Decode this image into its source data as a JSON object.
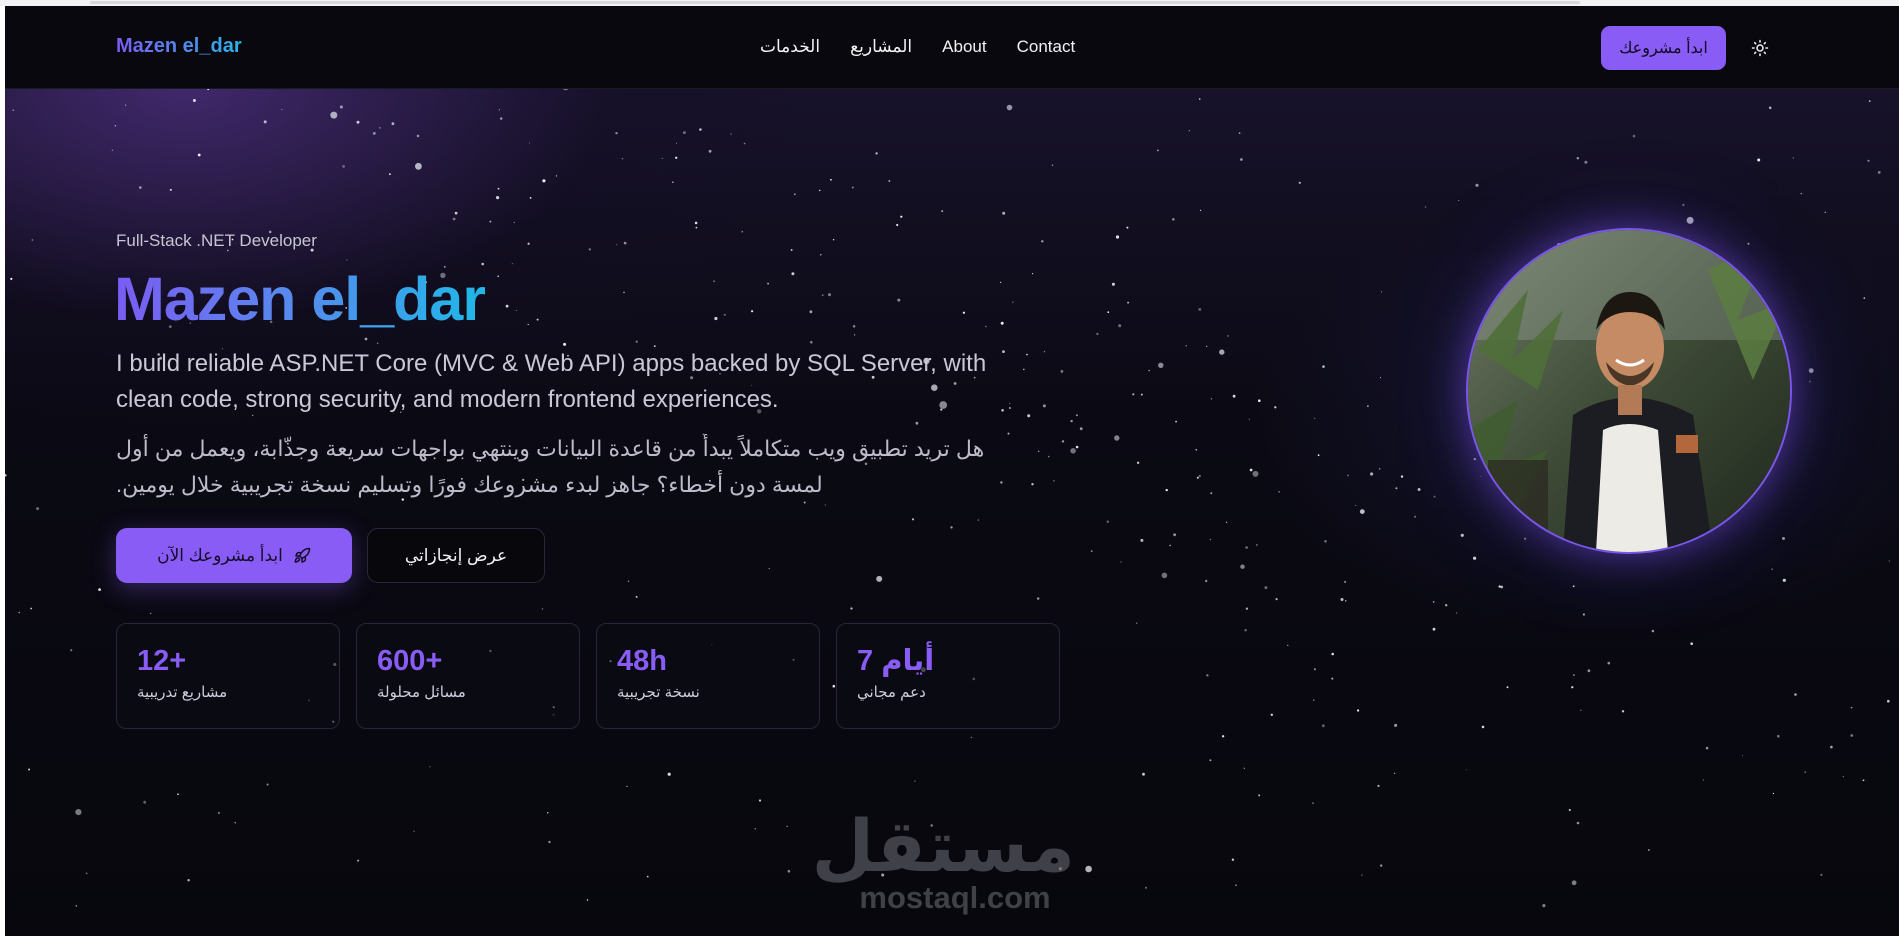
{
  "navbar": {
    "brand": "Mazen el_dar",
    "links": [
      {
        "label": "الخدمات",
        "key": "services"
      },
      {
        "label": "المشاريع",
        "key": "projects"
      },
      {
        "label": "About",
        "key": "about"
      },
      {
        "label": "Contact",
        "key": "contact"
      }
    ],
    "cta_label": "ابدأ مشروعك",
    "theme_icon": "sun-icon"
  },
  "hero": {
    "subtitle": "Full-Stack .NET Developer",
    "title": "Mazen el_dar",
    "desc_en": "I build reliable ASP.NET Core (MVC & Web API) apps backed by SQL Server, with clean code, strong security, and modern frontend experiences.",
    "desc_ar_line1": "هل تريد تطبيق ويب متكاملاً يبدأ من قاعدة البيانات وينتهي بواجهات سريعة وجذّابة، ويعمل من أول",
    "desc_ar_line2": "لمسة دون أخطاء؟ جاهز لبدء مشروعك فورًا وتسليم نسخة تجريبية خلال يومين.",
    "primary_button": "ابدأ مشروعك الآن",
    "primary_icon": "rocket-icon",
    "secondary_button": "عرض إنجازاتي"
  },
  "stats": [
    {
      "value": "12+",
      "label": "مشاريع تدريبية"
    },
    {
      "value": "600+",
      "label": "مسائل محلولة"
    },
    {
      "value": "48h",
      "label": "نسخة تجريبية"
    },
    {
      "value": "7 أيام",
      "label": "دعم مجاني"
    }
  ],
  "watermark": {
    "arabic": "مستقل",
    "latin": "mostaql.com"
  },
  "colors": {
    "accent": "#8a5cf6",
    "gradient_start": "#7a5cf2",
    "gradient_end": "#1fb8e8",
    "background": "#07070d"
  }
}
